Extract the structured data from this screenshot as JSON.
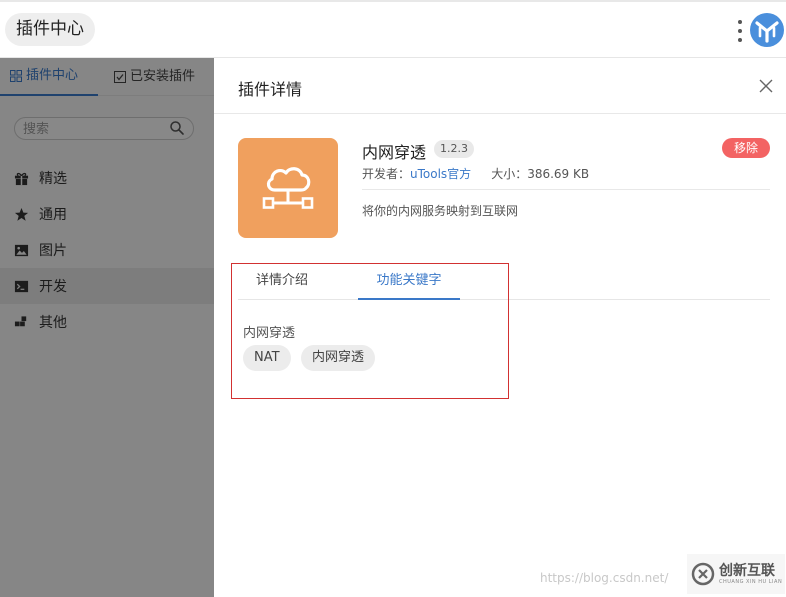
{
  "header": {
    "title": "插件中心"
  },
  "sidebar": {
    "tabs": [
      {
        "icon": "grid-icon",
        "label": "插件中心"
      },
      {
        "icon": "checkbox-icon",
        "label": "已安装插件"
      }
    ],
    "search_placeholder": "搜索",
    "items": [
      {
        "icon": "gift-icon",
        "label": "精选"
      },
      {
        "icon": "star-icon",
        "label": "通用"
      },
      {
        "icon": "image-icon",
        "label": "图片"
      },
      {
        "icon": "terminal-icon",
        "label": "开发"
      },
      {
        "icon": "blocks-icon",
        "label": "其他"
      }
    ],
    "active_index": 3
  },
  "detail": {
    "title": "插件详情",
    "plugin": {
      "icon": "cloud-network-icon",
      "icon_bg": "#f0a05e",
      "name": "内网穿透",
      "version": "1.2.3",
      "remove_label": "移除",
      "developer_label": "开发者：",
      "developer": "uTools官方",
      "size_label": "大小：",
      "size": "386.69 KB",
      "description": "将你的内网服务映射到互联网"
    },
    "tabs": [
      {
        "label": "详情介绍"
      },
      {
        "label": "功能关键字"
      }
    ],
    "active_tab": 1,
    "keywords": {
      "heading": "内网穿透",
      "items": [
        "NAT",
        "内网穿透"
      ]
    }
  },
  "watermark": {
    "url": "https://blog.csdn.net/",
    "brand": "创新互联",
    "brand_sub": "CHUANG XIN HU LIAN"
  },
  "colors": {
    "accent": "#3a78c8",
    "danger": "#f36363",
    "highlight": "#d23131"
  }
}
